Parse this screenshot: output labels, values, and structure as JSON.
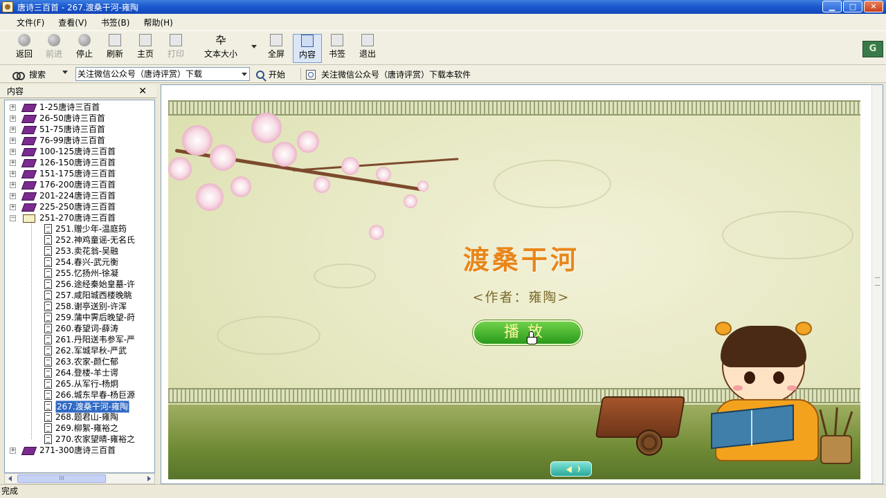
{
  "window": {
    "title": "唐诗三百首 - 267.渡桑干河-雍陶",
    "controls": {
      "minimize": "▁",
      "maximize": "□",
      "close": "✕"
    }
  },
  "menu": [
    "文件(F)",
    "查看(V)",
    "书签(B)",
    "帮助(H)"
  ],
  "toolbar": {
    "back": "返回",
    "forward": "前进",
    "stop": "停止",
    "refresh": "刷新",
    "home": "主页",
    "print": "打印",
    "text_size": "文本大小",
    "fullscreen": "全屏",
    "content": "内容",
    "bookmark": "书签",
    "exit": "退出"
  },
  "search": {
    "label": "搜索",
    "query": "关注微信公众号（唐诗评赏）下载",
    "go": "开始",
    "notice": "关注微信公众号（唐诗评赏）下载本软件"
  },
  "sidebar": {
    "title": "内容",
    "groups": [
      "1-25唐诗三百首",
      "26-50唐诗三百首",
      "51-75唐诗三百首",
      "76-99唐诗三百首",
      "100-125唐诗三百首",
      "126-150唐诗三百首",
      "151-175唐诗三百首",
      "176-200唐诗三百首",
      "201-224唐诗三百首",
      "225-250唐诗三百首",
      "251-270唐诗三百首"
    ],
    "open_items": [
      "251.赠少年-温庭筠",
      "252.神鸡童谣-无名氏",
      "253.卖花翁-吴融",
      "254.春兴-武元衡",
      "255.忆扬州-徐凝",
      "256.途经秦始皇墓-许",
      "257.咸阳城西楼晚眺",
      "258.谢亭送别-许浑",
      "259.蒲中霁后晚望-莳",
      "260.春望词-薛涛",
      "261.丹阳送韦参军-严",
      "262.军城早秋-严武",
      "263.农家-颜仁郁",
      "264.登楼-羊士谔",
      "265.从军行-杨炯",
      "266.城东早春-杨巨源",
      "267.渡桑干河-雍陶",
      "268.题君山-雍陶",
      "269.柳絮-雍裕之",
      "270.农家望晴-雍裕之"
    ],
    "selected": "267.渡桑干河-雍陶",
    "last_group": "271-300唐诗三百首",
    "scroll_grip": "III"
  },
  "poem": {
    "title": "渡桑干河",
    "author": "<作者：雍陶>",
    "play": "播放"
  },
  "status": "完成",
  "colors": {
    "title_orange": "#e8861a",
    "play_green": "#2b9a1c",
    "selection_blue": "#316ac5"
  }
}
